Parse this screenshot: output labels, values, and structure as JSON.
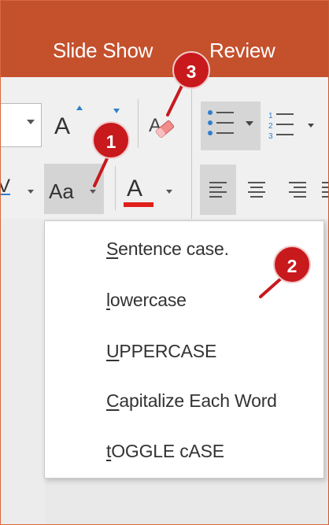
{
  "tabs": [
    "Slide Show",
    "Review"
  ],
  "case_button": {
    "label": "Aa"
  },
  "font_color_button": {
    "label": "A",
    "color": "#e0201b"
  },
  "grow_font_label": "A",
  "change_case_menu": {
    "items": [
      {
        "accel": "S",
        "rest": "entence case."
      },
      {
        "accel": "l",
        "rest": "owercase"
      },
      {
        "accel": "U",
        "rest": "PPERCASE"
      },
      {
        "accel": "C",
        "rest": "apitalize Each Word"
      },
      {
        "accel": "t",
        "rest": "OGGLE cASE"
      }
    ]
  },
  "callouts": [
    "1",
    "2",
    "3"
  ],
  "colors": {
    "titlebar": "#c4502c",
    "callout": "#c8191d",
    "accent_blue": "#2f7fcc"
  },
  "icons": [
    "dropdown-arrow",
    "grow-font",
    "clear-formatting",
    "bullets",
    "numbering",
    "change-case",
    "font-color",
    "align-left",
    "align-center",
    "align-right",
    "justify"
  ]
}
